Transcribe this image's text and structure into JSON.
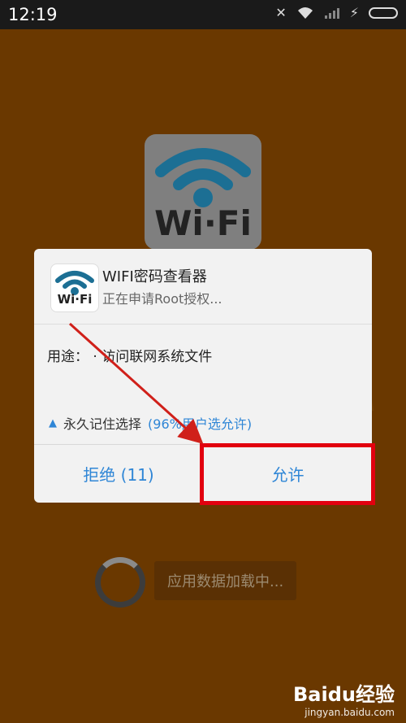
{
  "status_bar": {
    "time": "12:19",
    "icons": [
      "mute-icon",
      "wifi-icon",
      "signal-icon",
      "charging-icon",
      "battery-icon"
    ]
  },
  "background": {
    "logo_text": "Wi·Fi"
  },
  "dialog": {
    "app_icon_text": "Wi·Fi",
    "title": "WIFI密码查看器",
    "subtitle": "正在申请Root授权...",
    "usage_label": "用途：",
    "usage_text": "· 访问联网系统文件",
    "remember_label": "永久记住选择",
    "remember_pct": "(96%用户选允许)",
    "deny_button": "拒绝 (11)",
    "allow_button": "允许",
    "accent_color": "#2f86d6"
  },
  "loading": {
    "label": "应用数据加载中..."
  },
  "watermark": {
    "logo": "Baidu经验",
    "url": "jingyan.baidu.com"
  },
  "annotation": {
    "highlight_color": "#e2000f"
  }
}
